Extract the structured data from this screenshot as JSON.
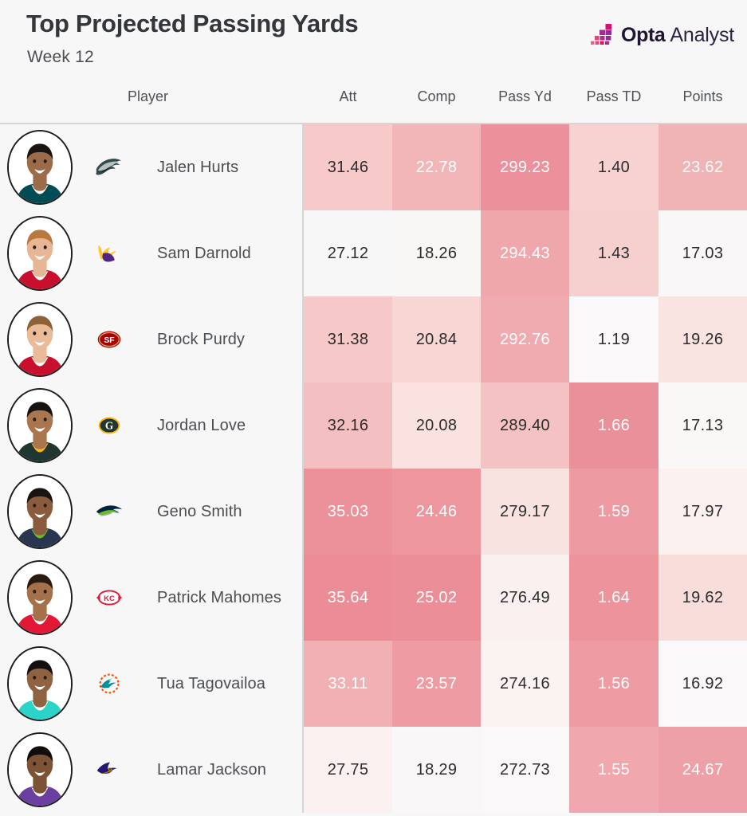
{
  "header": {
    "title": "Top Projected Passing Yards",
    "subtitle": "Week 12",
    "brand_opta": "Opta",
    "brand_analyst": "Analyst"
  },
  "columns": {
    "player": "Player",
    "att": "Att",
    "comp": "Comp",
    "pass_yd": "Pass Yd",
    "pass_td": "Pass TD",
    "points": "Points"
  },
  "colors": {
    "page_bg": "#f7f7f7",
    "rule": "#d6d6d6",
    "text_dark": "#2c2c2c",
    "text_light": "#ffffff",
    "heat_min": "#fbf4f4",
    "heat_max": "#e98e99",
    "brand_purple": "#201634",
    "brand_pink": "#e6007e"
  },
  "chart_data": {
    "type": "table",
    "title": "Top Projected Passing Yards",
    "subtitle": "Week 12",
    "columns": [
      "Player",
      "Att",
      "Comp",
      "Pass Yd",
      "Pass TD",
      "Points"
    ],
    "rows": [
      {
        "player": "Jalen Hurts",
        "team": "Philadelphia Eagles",
        "team_logo": "eagles-logo",
        "att": "31.46",
        "comp": "22.78",
        "pass_yd": "299.23",
        "pass_td": "1.40",
        "points": "23.62",
        "cell_colors": [
          "#f7c9c9",
          "#f2b6b8",
          "#ec909b",
          "#f7d2d1",
          "#f1b4b6"
        ],
        "text_modes": [
          "dark",
          "light",
          "light",
          "dark",
          "light"
        ]
      },
      {
        "player": "Sam Darnold",
        "team": "Minnesota Vikings",
        "team_logo": "vikings-logo",
        "att": "27.12",
        "comp": "18.26",
        "pass_yd": "294.43",
        "pass_td": "1.43",
        "points": "17.03",
        "cell_colors": [
          "#f8f7f7",
          "#f9f6f6",
          "#efa7ac",
          "#f6cfcf",
          "#f9f7f7"
        ],
        "text_modes": [
          "dark",
          "dark",
          "light",
          "dark",
          "dark"
        ]
      },
      {
        "player": "Brock Purdy",
        "team": "San Francisco 49ers",
        "team_logo": "49ers-logo",
        "att": "31.38",
        "comp": "20.84",
        "pass_yd": "292.76",
        "pass_td": "1.19",
        "points": "19.26",
        "cell_colors": [
          "#f6c8c7",
          "#f7d6d4",
          "#f0abb0",
          "#faf8f8",
          "#f9e4e2"
        ],
        "text_modes": [
          "dark",
          "dark",
          "light",
          "dark",
          "dark"
        ]
      },
      {
        "player": "Jordan Love",
        "team": "Green Bay Packers",
        "team_logo": "packers-logo",
        "att": "32.16",
        "comp": "20.08",
        "pass_yd": "289.40",
        "pass_td": "1.66",
        "points": "17.13",
        "cell_colors": [
          "#f4bfc0",
          "#f9e2e0",
          "#f4c2c2",
          "#ea909b",
          "#faf7f7"
        ],
        "text_modes": [
          "dark",
          "dark",
          "dark",
          "light",
          "dark"
        ]
      },
      {
        "player": "Geno Smith",
        "team": "Seattle Seahawks",
        "team_logo": "seahawks-logo",
        "att": "35.03",
        "comp": "24.46",
        "pass_yd": "279.17",
        "pass_td": "1.59",
        "points": "17.97",
        "cell_colors": [
          "#ec9099",
          "#ed969e",
          "#f9e3e1",
          "#ed9aa2",
          "#fbf1ef"
        ],
        "text_modes": [
          "light",
          "light",
          "dark",
          "light",
          "dark"
        ]
      },
      {
        "player": "Patrick Mahomes",
        "team": "Kansas City Chiefs",
        "team_logo": "chiefs-logo",
        "att": "35.64",
        "comp": "25.02",
        "pass_yd": "276.49",
        "pass_td": "1.64",
        "points": "19.62",
        "cell_colors": [
          "#eb8c96",
          "#eb8e98",
          "#faf0ee",
          "#ec939c",
          "#f8dddb"
        ],
        "text_modes": [
          "light",
          "light",
          "dark",
          "light",
          "dark"
        ]
      },
      {
        "player": "Tua Tagovailoa",
        "team": "Miami Dolphins",
        "team_logo": "dolphins-logo",
        "att": "33.11",
        "comp": "23.57",
        "pass_yd": "274.16",
        "pass_td": "1.56",
        "points": "16.92",
        "cell_colors": [
          "#f1b0b4",
          "#ee9ba3",
          "#fbf3f1",
          "#ee9ba3",
          "#faf8f8"
        ],
        "text_modes": [
          "light",
          "light",
          "dark",
          "light",
          "dark"
        ]
      },
      {
        "player": "Lamar Jackson",
        "team": "Baltimore Ravens",
        "team_logo": "ravens-logo",
        "att": "27.75",
        "comp": "18.29",
        "pass_yd": "272.73",
        "pass_td": "1.55",
        "points": "24.67",
        "cell_colors": [
          "#fbf1f0",
          "#f9f7f7",
          "#faf8f8",
          "#f0a8ae",
          "#eda0a7"
        ],
        "text_modes": [
          "dark",
          "dark",
          "dark",
          "light",
          "light"
        ]
      }
    ],
    "numeric": {
      "att": [
        31.46,
        27.12,
        31.38,
        32.16,
        35.03,
        35.64,
        33.11,
        27.75
      ],
      "comp": [
        22.78,
        18.26,
        20.84,
        20.08,
        24.46,
        25.02,
        23.57,
        18.29
      ],
      "pass_yd": [
        299.23,
        294.43,
        292.76,
        289.4,
        279.17,
        276.49,
        274.16,
        272.73
      ],
      "pass_td": [
        1.4,
        1.43,
        1.19,
        1.66,
        1.59,
        1.64,
        1.56,
        1.55
      ],
      "points": [
        23.62,
        17.03,
        19.26,
        17.13,
        17.97,
        19.62,
        16.92,
        24.67
      ]
    }
  }
}
